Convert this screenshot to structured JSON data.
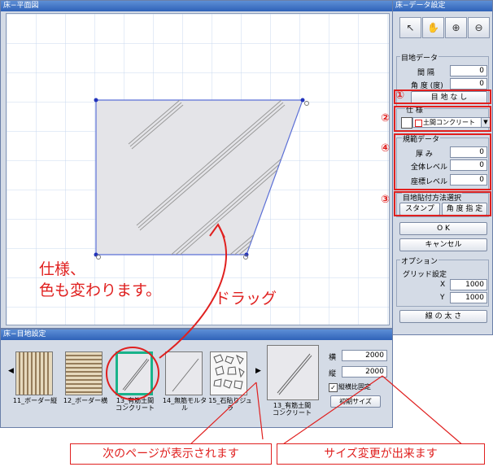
{
  "plan_window": {
    "title": "床−平面図"
  },
  "props_window": {
    "title": "床−データ設定",
    "tools": [
      "pointer-icon",
      "hand-icon",
      "zoom-in-icon",
      "zoom-out-icon"
    ],
    "joint_data": {
      "label": "目地データ",
      "interval_label": "間 隔",
      "interval_value": "0",
      "angle_label": "角 度 (度)",
      "angle_value": "0",
      "none_button": "目 地 な し"
    },
    "spec": {
      "label": "仕 様",
      "value": "土間コンクリート",
      "swatch_color": "#e0201f"
    },
    "attach": {
      "label": "規範データ",
      "thickness_label": "厚 み",
      "thickness_value": "0",
      "overall_label": "全体レベル",
      "overall_value": "0",
      "coord_label": "座標レベル",
      "coord_value": "0"
    },
    "method": {
      "label": "目地貼付方法選択",
      "stamp_button": "スタンプ",
      "angle_button": "角 度 指 定"
    },
    "ok_button": "O K",
    "cancel_button": "キャンセル",
    "options": {
      "label": "オプション",
      "grid_label": "グリッド設定",
      "x_label": "X",
      "x_value": "1000",
      "y_label": "Y",
      "y_value": "1000"
    },
    "line_button": "線 の 太 さ"
  },
  "joint_window": {
    "title": "床−目地設定",
    "thumbnails": [
      "11_ボーダー縦",
      "12_ボーダー横",
      "13_有筋土間\nコンクリート",
      "14_無筋モルタル",
      "15_石貼りジュラ"
    ],
    "preview_caption": "13_有筋土間\nコンクリート",
    "w_label": "横",
    "w_value": "2000",
    "h_label": "縦",
    "h_value": "2000",
    "keep_ratio_label": "縦横比固定",
    "keep_ratio_checked": true,
    "initial_size_button": "初期サイズ"
  },
  "annotations": {
    "markers": [
      "①",
      "②",
      "④",
      "③"
    ],
    "spec_note_line1": "仕様、",
    "spec_note_line2": "色も変わります。",
    "drag_note": "ドラッグ",
    "next_page_note": "次のページが表示されます",
    "resize_note": "サイズ変更が出来ます"
  }
}
